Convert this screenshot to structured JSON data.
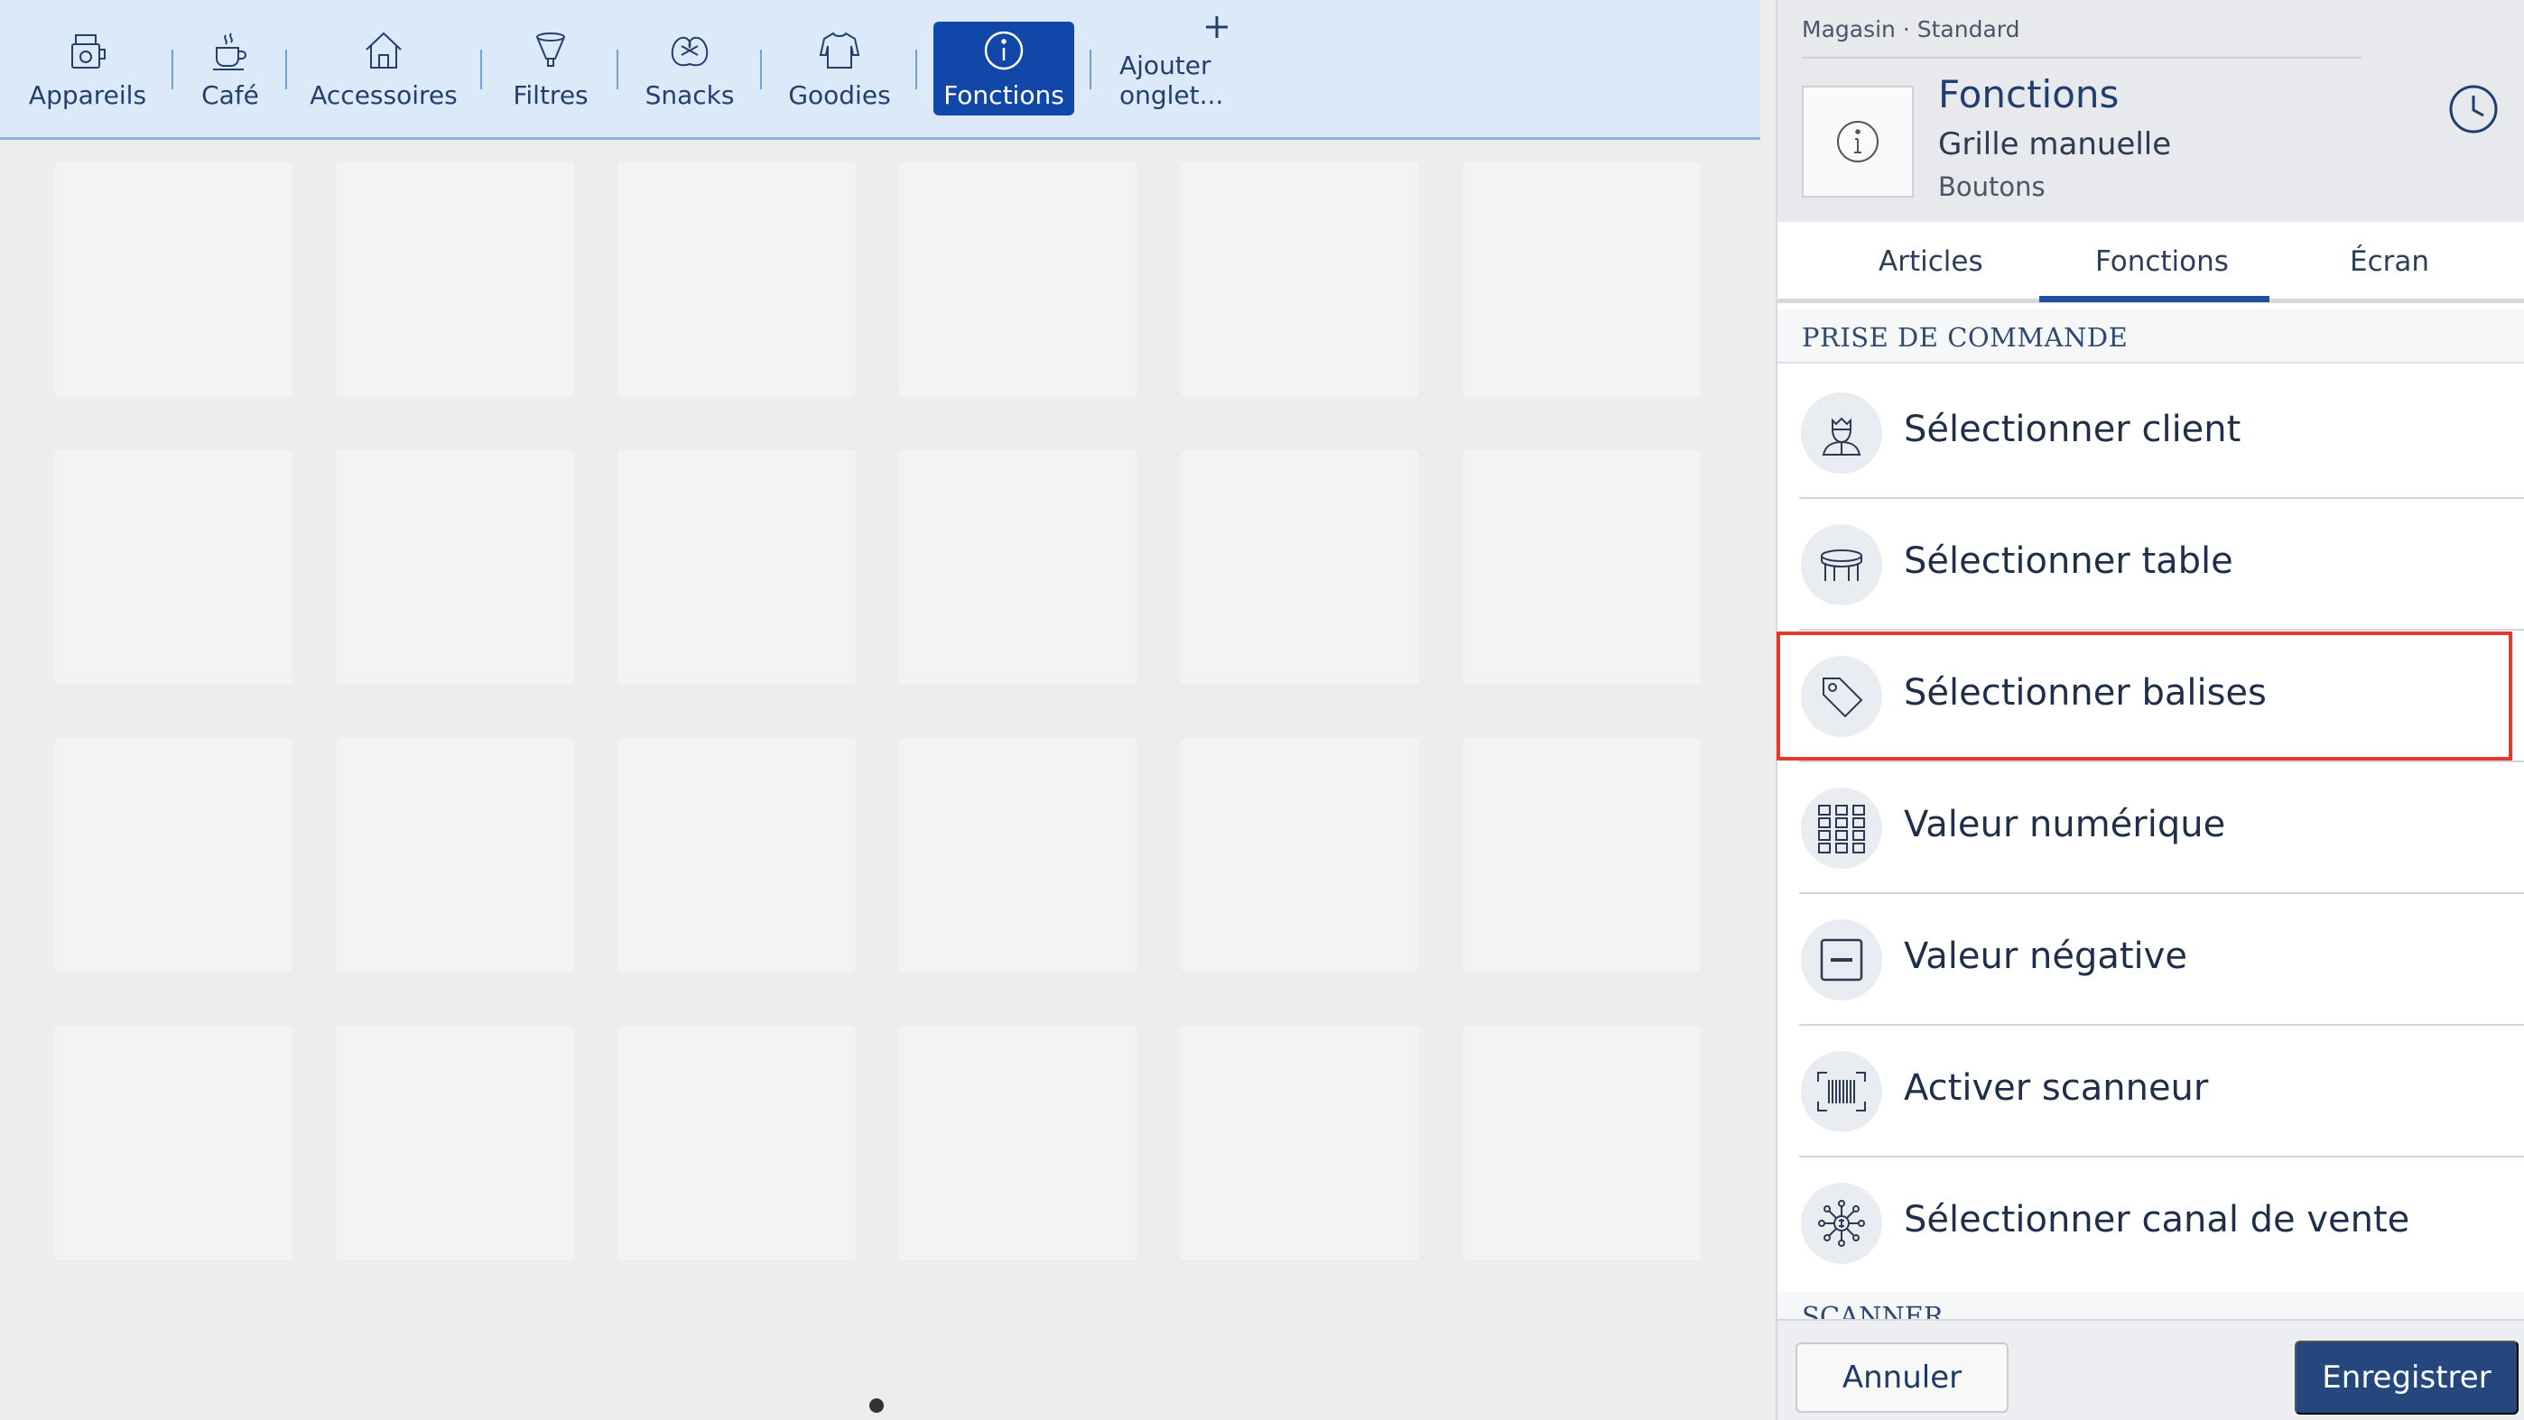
{
  "tabs": [
    {
      "label": "Appareils",
      "icon": "appliance-icon"
    },
    {
      "label": "Café",
      "icon": "coffee-cup-icon"
    },
    {
      "label": "Accessoires",
      "icon": "house-icon"
    },
    {
      "label": "Filtres",
      "icon": "filter-icon"
    },
    {
      "label": "Snacks",
      "icon": "pretzel-icon"
    },
    {
      "label": "Goodies",
      "icon": "sweater-icon"
    },
    {
      "label": "Fonctions",
      "icon": "info-icon",
      "active": true
    },
    {
      "label": "Ajouter onglet...",
      "icon": "plus-icon"
    }
  ],
  "panel": {
    "breadcrumb": "Magasin · Standard",
    "title": "Fonctions",
    "subtitle": "Grille manuelle",
    "subtitle2": "Boutons",
    "tabs": [
      "Articles",
      "Fonctions",
      "Écran"
    ],
    "active_tab": "Fonctions",
    "section": "PRISE DE COMMANDE",
    "items": [
      {
        "label": "Sélectionner client",
        "icon": "customer-icon"
      },
      {
        "label": "Sélectionner table",
        "icon": "table-icon"
      },
      {
        "label": "Sélectionner balises",
        "icon": "tag-icon",
        "highlighted": true
      },
      {
        "label": "Valeur numérique",
        "icon": "keypad-icon"
      },
      {
        "label": "Valeur négative",
        "icon": "minus-box-icon"
      },
      {
        "label": "Activer scanneur",
        "icon": "barcode-icon"
      },
      {
        "label": "Sélectionner canal de vente",
        "icon": "sales-channel-icon"
      }
    ],
    "next_section": "SCANNER",
    "cancel_label": "Annuler",
    "save_label": "Enregistrer"
  },
  "colors": {
    "tabbar_bg": "#dbe9f8",
    "active_tab": "#1147a9",
    "highlight": "#e23a2e",
    "save_button": "#25477d"
  }
}
